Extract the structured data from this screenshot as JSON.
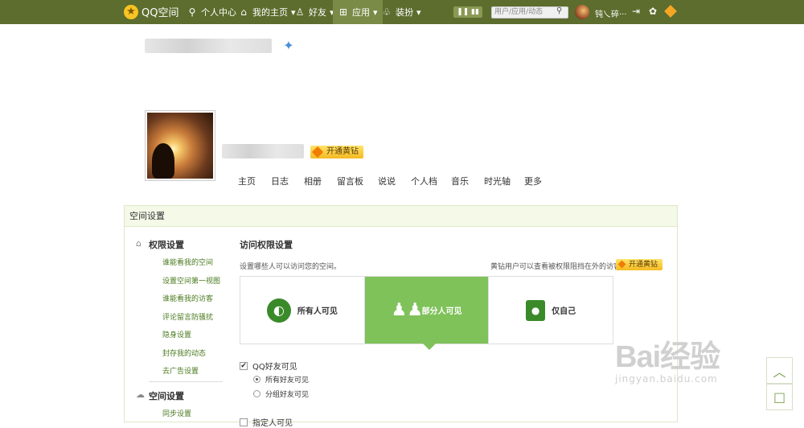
{
  "topbar": {
    "logo_text": "QQ空间",
    "nav": [
      {
        "icon": "person-icon",
        "label": "个人中心"
      },
      {
        "icon": "home-icon",
        "label": "我的主页"
      },
      {
        "icon": "friends-icon",
        "label": "好友"
      },
      {
        "icon": "apps-icon",
        "label": "应用"
      },
      {
        "icon": "shirt-icon",
        "label": "装扮"
      }
    ],
    "search_placeholder": "用户/应用/动态",
    "username": "钝乀碎···"
  },
  "profile": {
    "vip_badge": "开通黄钻",
    "tabs": [
      "主页",
      "日志",
      "相册",
      "留言板",
      "说说",
      "个人档",
      "音乐",
      "时光轴",
      "更多"
    ]
  },
  "panel": {
    "title": "空间设置",
    "sidebar": {
      "section1_title": "权限设置",
      "section1_links": [
        "谁能看我的空间",
        "设置空间第一视图",
        "谁能看我的访客",
        "评论留言防骚扰",
        "隐身设置",
        "封存我的动态",
        "去广告设置"
      ],
      "section2_title": "空间设置",
      "section2_links": [
        "同步设置"
      ]
    },
    "content": {
      "title": "访问权限设置",
      "desc": "设置哪些人可以访问您的空间。",
      "vip_note": "黄钻用户可以查看被权限阻挡在外的访客",
      "vip_button": "开通黄钻",
      "options": [
        {
          "label": "所有人可见",
          "icon": "globe-icon",
          "selected": false
        },
        {
          "label": "部分人可见",
          "icon": "people-icon",
          "selected": true
        },
        {
          "label": "仅自己",
          "icon": "lock-icon",
          "selected": false
        }
      ],
      "check1": "QQ好友可见",
      "radio1": "所有好友可见",
      "radio2": "分组好友可见",
      "check2": "指定人可见"
    }
  },
  "watermark": {
    "main": "Bai经验",
    "sub": "jingyan.baidu.com"
  },
  "colors": {
    "topbar": "#5c6d2e",
    "accent_green": "#7fc25a",
    "link_green": "#4a7a1e"
  }
}
